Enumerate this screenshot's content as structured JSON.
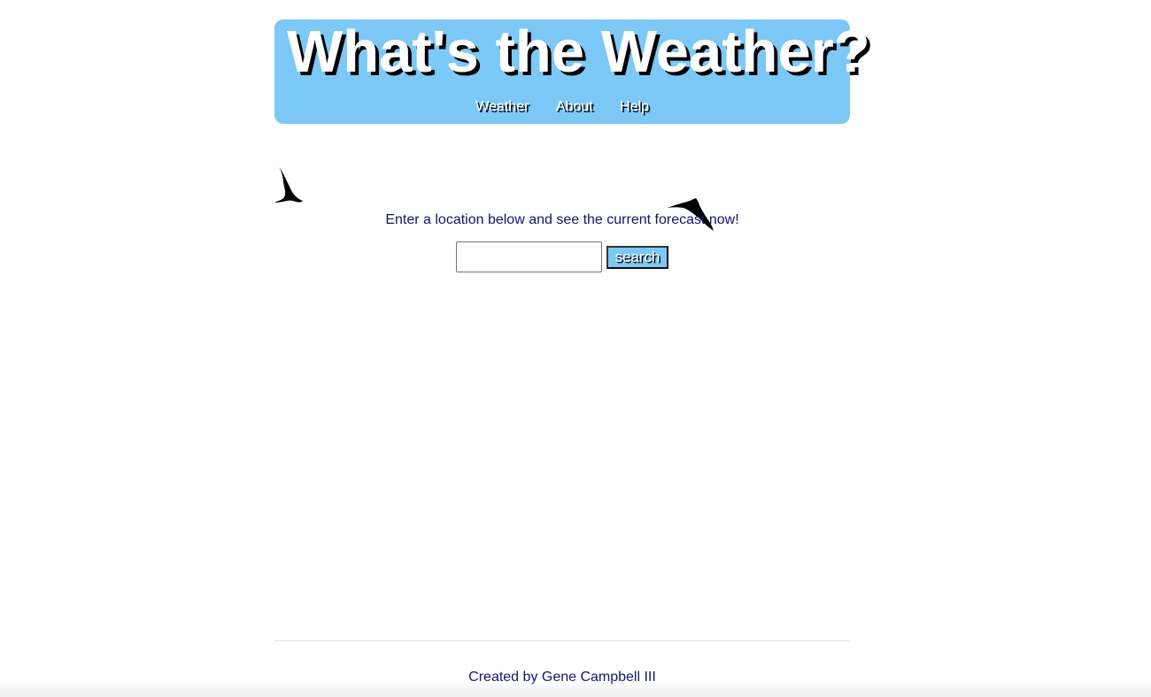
{
  "header": {
    "title": "What's the Weather?",
    "background_color": "#7cc8f6",
    "nav": [
      {
        "label": "Weather"
      },
      {
        "label": "About"
      },
      {
        "label": "Help"
      }
    ]
  },
  "main": {
    "intro_text": "Enter a location below and see the current forecast now!",
    "search": {
      "value": "",
      "placeholder": "",
      "button_label": "search"
    },
    "decorations": [
      "bird-silhouette-icon",
      "bird-silhouette-icon"
    ]
  },
  "footer": {
    "credit": "Created by Gene Campbell III"
  }
}
